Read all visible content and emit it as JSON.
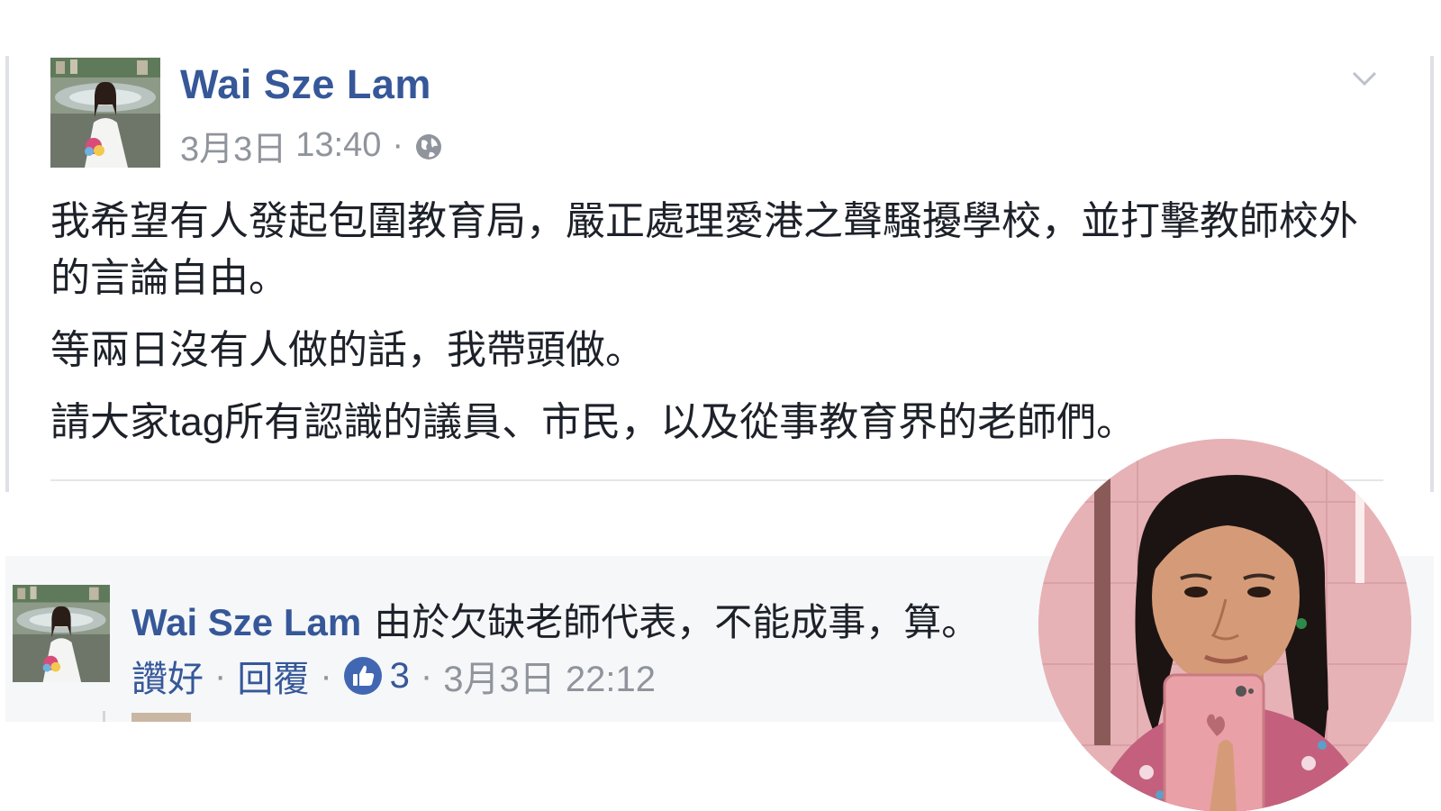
{
  "post": {
    "author": "Wai Sze Lam",
    "date": "3月3日",
    "time": "13:40",
    "meta_separator": "·",
    "privacy_icon": "globe-icon",
    "menu_icon": "chevron-down-icon",
    "paragraphs": [
      "我希望有人發起包圍教育局，嚴正處理愛港之聲騷擾學校，並打擊教師校外的言論自由。",
      "等兩日沒有人做的話，我帶頭做。",
      "請大家tag所有認識的議員、市民，以及從事教育界的老師們。"
    ]
  },
  "comment": {
    "author": "Wai Sze Lam",
    "text": "由於欠缺老師代表，不能成事，算。",
    "like_label": "讚好",
    "reply_label": "回覆",
    "separator": "·",
    "reaction_icon": "thumbs-up-icon",
    "reaction_count": "3",
    "timestamp": "3月3日 22:12"
  },
  "colors": {
    "name_blue": "#365899",
    "text_dark": "#1d2129",
    "meta_gray": "#90949c",
    "comment_bg": "#f6f7f9",
    "like_blue": "#4267b2"
  }
}
